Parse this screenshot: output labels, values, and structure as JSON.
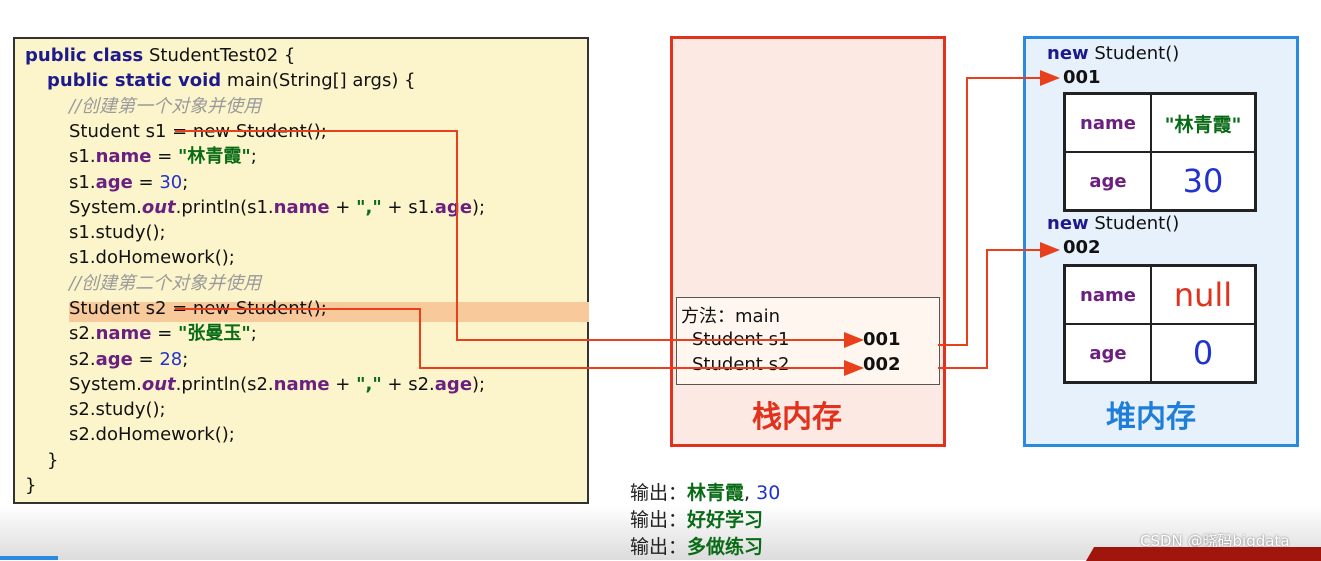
{
  "code": {
    "line1": {
      "kw": "public class",
      "rest": " StudentTest02 {"
    },
    "line2": {
      "kw": "public static void",
      "rest": " main(String[] args) {"
    },
    "comment1": "//创建第一个对象并使用",
    "line4": "Student s1 = new Student();",
    "s1_name": {
      "obj": "s1.",
      "field": "name",
      "eq": " = ",
      "val": "\"林青霞\"",
      "end": ";"
    },
    "s1_age": {
      "obj": "s1.",
      "field": "age",
      "eq": " = ",
      "val": "30",
      "end": ";"
    },
    "s1_print": {
      "a": "System.",
      "out": "out",
      "b": ".println(s1.",
      "f1": "name",
      "c": " + ",
      "str": "\",\"",
      "d": " + s1.",
      "f2": "age",
      "e": ");"
    },
    "s1_study": "s1.study();",
    "s1_hw": "s1.doHomework();",
    "comment2": "//创建第二个对象并使用",
    "line11": "Student s2 = new Student();",
    "s2_name": {
      "obj": "s2.",
      "field": "name",
      "eq": " = ",
      "val": "\"张曼玉\"",
      "end": ";"
    },
    "s2_age": {
      "obj": "s2.",
      "field": "age",
      "eq": " = ",
      "val": "28",
      "end": ";"
    },
    "s2_print": {
      "a": "System.",
      "out": "out",
      "b": ".println(s2.",
      "f1": "name",
      "c": " + ",
      "str": "\",\"",
      "d": " + s2.",
      "f2": "age",
      "e": ");"
    },
    "s2_study": "s2.study();",
    "s2_hw": "s2.doHomework();",
    "close1": "}",
    "close2": "}"
  },
  "stack": {
    "method": "方法：main",
    "var1": "Student s1",
    "addr1": "001",
    "var2": "Student s2",
    "addr2": "002",
    "title": "栈内存"
  },
  "heap": {
    "title": "堆内存",
    "objects": [
      {
        "label": "new Student()",
        "addr": "001",
        "name_key": "name",
        "name_val": "\"林青霞\"",
        "age_key": "age",
        "age_val": "30"
      },
      {
        "label": "new Student()",
        "addr": "002",
        "name_key": "name",
        "name_val": "null",
        "age_key": "age",
        "age_val": "0"
      }
    ]
  },
  "output": {
    "prefix": "输出：",
    "line1_name": "林青霞",
    "line1_sep": ", ",
    "line1_age": "30",
    "line2": "好好学习",
    "line3": "多做练习"
  },
  "watermark": "CSDN @晓码bigdata",
  "colors": {
    "stack_border": "#e0321c",
    "heap_border": "#2a8ae0",
    "arrow": "#e8401c"
  }
}
